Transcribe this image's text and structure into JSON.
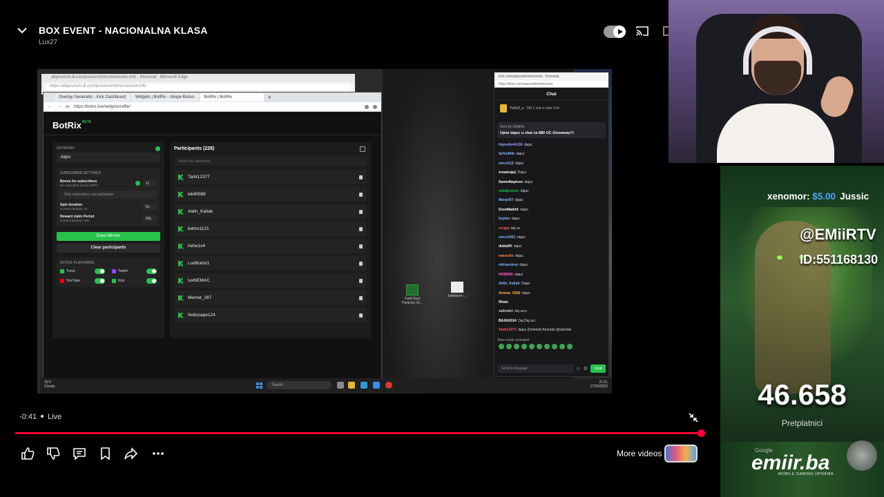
{
  "player": {
    "title": "BOX EVENT - NACIONALNA KLASA",
    "channel": "Lux27",
    "time": "-0:41",
    "live_label": "Live",
    "progress": 1.0,
    "more_videos_label": "More videos"
  },
  "colors": {
    "accent_red": "#ff0033",
    "kick_green": "#27c24c",
    "donation_blue": "#4ea3ff"
  },
  "browser_back": {
    "tab": "abpoursch.di.com/pocoursch/com/session-info - Personal - Microsoft Edge",
    "url": "https://abpoursch.di.com/pocoursch/env/session-info"
  },
  "browser": {
    "tabs": [
      "Overlay Generator - Kick Dashboard",
      "Widgets | BotRix - Ukupe Bonus",
      "BotRix | BotRix"
    ],
    "url": "https://botrix.live/widgets/raffle/"
  },
  "botrix": {
    "brand": "BotRix",
    "beta": "BETA",
    "keyword_label": "KEYWORD",
    "keyword_value": "dajuc",
    "subscriber_settings_label": "SUBSCRIBER SETTINGS",
    "bonus_title": "Bonus for subscribers",
    "bonus_sub": "No subscriber bonus (OFF)",
    "bonus_value": "x1",
    "only_subs": "Only subscribers can participate",
    "spin_title": "Spin duration",
    "spin_sub": "Current duration: 5s",
    "spin_value": "5s",
    "claim_title": "Reward claim Period",
    "claim_sub": "Current duration: 60s",
    "claim_value": "60s",
    "draw_button": "Draw Winner",
    "clear_button": "Clear participants",
    "platforms_label": "ACTIVE PLATFORMS",
    "platforms": [
      {
        "name": "Trovo",
        "color": "#27c24c"
      },
      {
        "name": "Twitch",
        "color": "#9146ff"
      },
      {
        "name": "YouTube",
        "color": "#ff0000"
      },
      {
        "name": "Kick",
        "color": "#27c24c"
      }
    ],
    "participants_title": "Participants (228)",
    "search_placeholder": "Search by username...",
    "participants": [
      "Tarik12377",
      "lekil0088",
      "Aldin_Kaltak",
      "bahro1121",
      "hehe1v4",
      "LudiKarlo1",
      "luxNEMAC",
      "Memet_287",
      "Notiscape124"
    ]
  },
  "desktop": {
    "icon1": "Gold Dust Particles Gr...",
    "icon2": "baltimore-..."
  },
  "taskbar": {
    "weather_temp": "35°F",
    "weather_cond": "Cloudy",
    "search": "Search",
    "time": "21:51",
    "date": "27/03/2025"
  },
  "chat": {
    "window_title": "kick.com/popout/emiirtv/chat - Personal",
    "url": "https://kick.com/popout/emiirtv/chat",
    "header": "Chat",
    "gift_user": "TuXxX_x",
    "gift_text": "Gift 1 sub to take 2nd",
    "pinned_by": "Sent by  EMiiRtv",
    "pinned_text": "Upisi dajuc u chat za 880 UC Giveaway!!!",
    "messages": [
      {
        "user": "Hajrudin44128",
        "text": "dajuc",
        "color": "#9aa6ff"
      },
      {
        "user": "farhod8ib",
        "text": "dajuc",
        "color": "#7fb7ff"
      },
      {
        "user": "emco013",
        "text": "dajuc",
        "color": "#7fb7ff"
      },
      {
        "user": "ersadcajuj",
        "text": "Dajuc",
        "color": "#ffffff"
      },
      {
        "user": "Samedkapicee",
        "text": "dajuc",
        "color": "#ffffff"
      },
      {
        "user": "mladjenovic",
        "text": "dajuc",
        "color": "#27c24c"
      },
      {
        "user": "Manjel97",
        "text": "dajuc",
        "color": "#7fb7ff"
      },
      {
        "user": "DzeoMadrid",
        "text": "dajuc",
        "color": "#ffffff"
      },
      {
        "user": "bojeko",
        "text": "dajuc",
        "color": "#7fb7ff"
      },
      {
        "user": "srcppi",
        "text": "daj uc",
        "color": "#ff5c5c"
      },
      {
        "user": "emco1001",
        "text": "dajuc",
        "color": "#7fb7ff"
      },
      {
        "user": "dubia00",
        "text": "dajuc",
        "color": "#ffffff"
      },
      {
        "user": "eskmollz",
        "text": "dajuc",
        "color": "#ff8a3d"
      },
      {
        "user": "sikhaestrea",
        "text": "dajuc",
        "color": "#7fb7ff"
      },
      {
        "user": "N00BIN0",
        "text": "dajuc",
        "color": "#ff5cc8"
      },
      {
        "user": "Aldin_Kaltak",
        "text": "Dajuc",
        "color": "#7fb7ff"
      },
      {
        "user": "Ammar_5566",
        "text": "dajuc",
        "color": "#ffb347"
      },
      {
        "user": "Rhaix",
        "text": "",
        "color": "#ffffff"
      },
      {
        "user": "sallmdet",
        "text": "daj uccc",
        "color": "#cccccc"
      },
      {
        "user": "BAXA0014",
        "text": "Daj Daj ucc",
        "color": "#ffffff"
      },
      {
        "user": "Tarik12377",
        "text": "dajuc (Deleted) Amonda @ubertah",
        "color": "#ff5c5c"
      }
    ],
    "slow_mode": "Slow mode activated",
    "send_placeholder": "Send a message",
    "chat_button": "Chat"
  },
  "overlay": {
    "donation_user": "xenomor:",
    "donation_amount": "$5.00",
    "donation_user2": "Jussic",
    "handle": "@EMiiRTV",
    "id": "ID:551168130",
    "subscribers": "46.658",
    "subscribers_label": "Pretplatnici",
    "google": "Google",
    "site": "emiir.ba",
    "tagline": "MOBILE GAMING OPREMA"
  }
}
